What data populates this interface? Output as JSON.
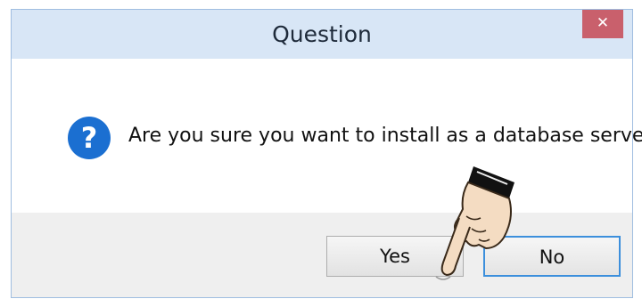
{
  "dialog": {
    "title": "Question",
    "close_icon": "close-icon",
    "message": "Are you sure you want to install as a database server?",
    "question_icon": "question-icon",
    "buttons": {
      "yes_label": "Yes",
      "no_label": "No"
    },
    "pointer_icon": "pointing-hand-icon"
  },
  "colors": {
    "titlebar": "#d8e6f6",
    "close_button": "#c9606c",
    "question_icon": "#1b6fd1",
    "footer": "#efefef",
    "no_button_focus_border": "#3c8fdc"
  }
}
